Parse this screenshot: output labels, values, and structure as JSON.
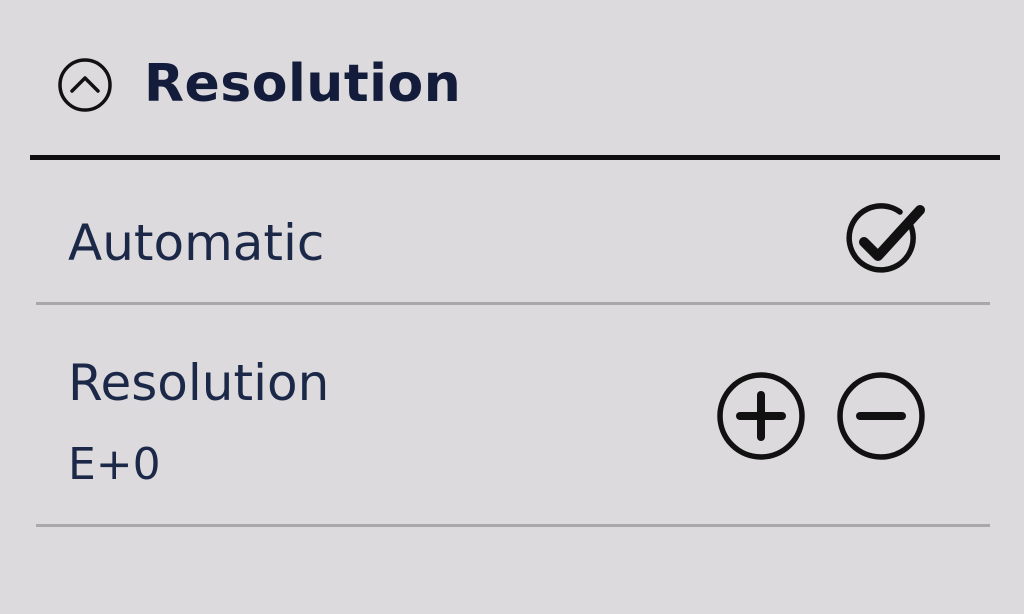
{
  "header": {
    "title": "Resolution",
    "collapse_icon": "chevron-up-circle-icon"
  },
  "settings": {
    "automatic": {
      "label": "Automatic",
      "checked": true,
      "icon": "check-circle-icon"
    },
    "resolution": {
      "label": "Resolution",
      "value": "E+0",
      "increase_icon": "plus-circle-icon",
      "decrease_icon": "minus-circle-icon"
    }
  },
  "colors": {
    "background": "#dcdadc",
    "text": "#1c2848",
    "divider": "#a9a7a9",
    "header_rule": "#0e0e0e"
  }
}
